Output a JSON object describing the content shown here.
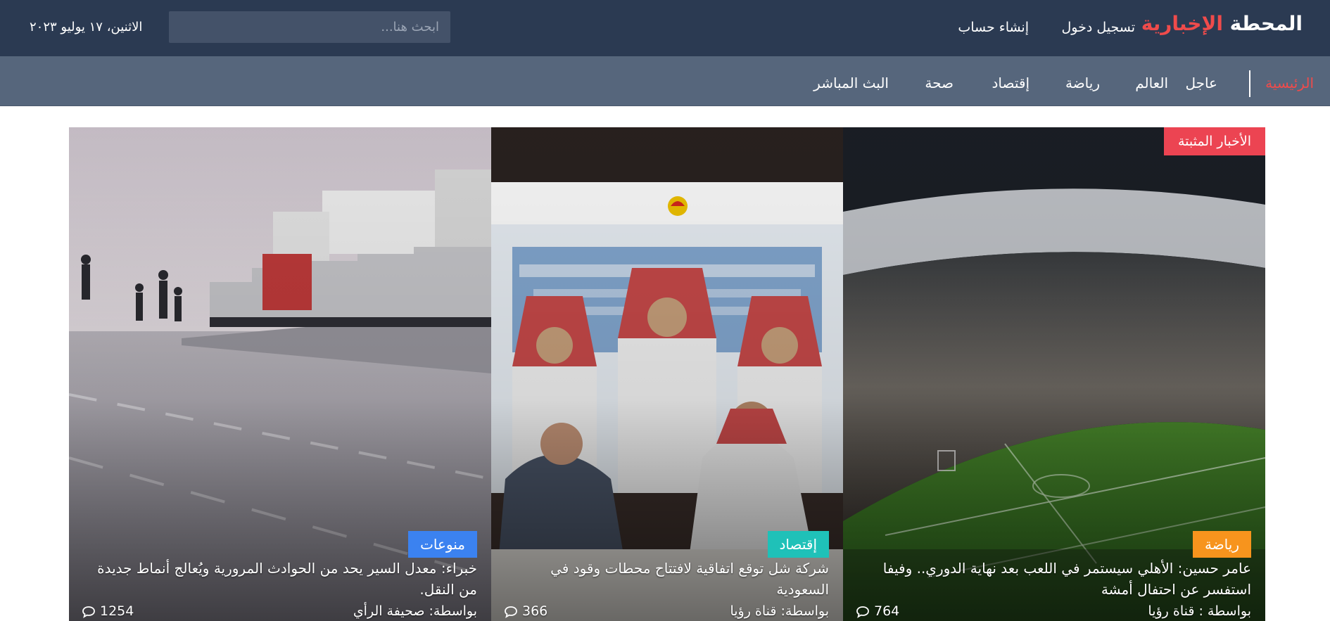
{
  "header": {
    "logo_main": "المحطة",
    "logo_accent": "الإخبارية",
    "login_label": "تسجيل دخول",
    "signup_label": "إنشاء حساب",
    "search_placeholder": "ابحث هنا...",
    "date": "الاثنين، ١٧ يوليو ٢٠٢٣"
  },
  "nav": {
    "items": [
      {
        "label": "الرئيسية"
      },
      {
        "label": "عاجل"
      },
      {
        "label": "العالم"
      },
      {
        "label": "رياضة"
      },
      {
        "label": "إقتصاد"
      },
      {
        "label": "صحة"
      },
      {
        "label": "البث المباشر"
      }
    ]
  },
  "featured": {
    "pinned_label": "الأخبار المثبتة",
    "cards": [
      {
        "category": "رياضة",
        "category_color": "#f7941d",
        "title": "عامر حسين: الأهلي سيستمر في اللعب بعد نهاية الدوري.. وفيفا استفسر عن احتفال أمشة",
        "source": "بواسطة : قناة رؤيا",
        "comments": "764"
      },
      {
        "category": "إقتصاد",
        "category_color": "#1fc1b8",
        "title": "شركة شل توقع اتفاقية لافتتاح محطات وقود في السعودية",
        "source": "بواسطة: قناة رؤيا",
        "comments": "366"
      },
      {
        "category": "منوعات",
        "category_color": "#3b82f0",
        "title": "خبراء: معدل السير يحد من الحوادث المرورية ويُعالج أنماط جديدة من النقل.",
        "source": "بواسطة: صحيفة الرأي",
        "comments": "1254"
      }
    ]
  },
  "colors": {
    "header_bg": "#2b3a52",
    "nav_bg": "#56667c",
    "accent_red": "#ef4b4b"
  }
}
